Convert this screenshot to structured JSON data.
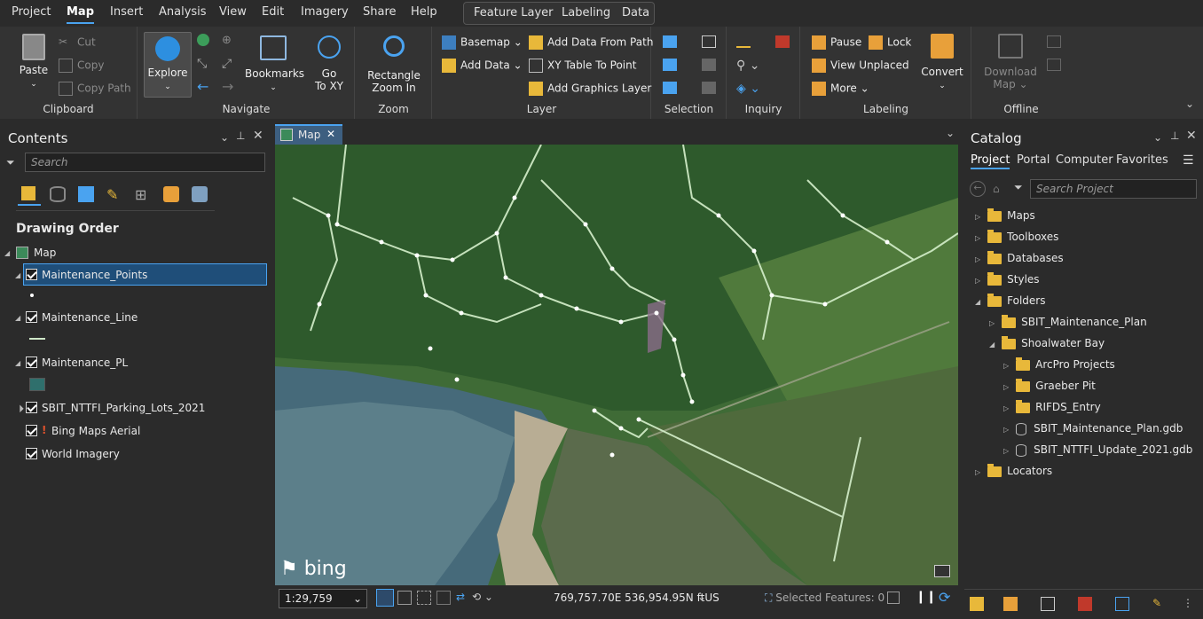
{
  "menu": {
    "tabs": [
      "Project",
      "Map",
      "Insert",
      "Analysis",
      "View",
      "Edit",
      "Imagery",
      "Share",
      "Help"
    ],
    "active": "Map",
    "context_tabs": [
      "Feature Layer",
      "Labeling",
      "Data"
    ]
  },
  "ribbon": {
    "clipboard": {
      "label": "Clipboard",
      "paste": "Paste",
      "cut": "Cut",
      "copy": "Copy",
      "copy_path": "Copy Path"
    },
    "navigate": {
      "label": "Navigate",
      "explore": "Explore",
      "bookmarks": "Bookmarks",
      "go_to_xy_1": "Go",
      "go_to_xy_2": "To XY"
    },
    "zoom": {
      "label": "Zoom",
      "rect1": "Rectangle",
      "rect2": "Zoom In"
    },
    "layer": {
      "label": "Layer",
      "basemap": "Basemap",
      "add_data": "Add Data",
      "add_data_from_path": "Add Data From Path",
      "xy_table": "XY Table To Point",
      "add_graphics": "Add Graphics Layer"
    },
    "selection": {
      "label": "Selection"
    },
    "inquiry": {
      "label": "Inquiry"
    },
    "labeling": {
      "label": "Labeling",
      "pause": "Pause",
      "lock": "Lock",
      "view_unplaced": "View Unplaced",
      "more": "More",
      "convert": "Convert"
    },
    "offline": {
      "label": "Offline",
      "download1": "Download",
      "download2": "Map"
    }
  },
  "contents": {
    "title": "Contents",
    "search_placeholder": "Search",
    "drawing_order": "Drawing Order",
    "map": "Map",
    "layers": [
      "Maintenance_Points",
      "Maintenance_Line",
      "Maintenance_PL",
      "SBIT_NTTFI_Parking_Lots_2021",
      "Bing Maps Aerial",
      "World Imagery"
    ]
  },
  "map": {
    "tab": "Map",
    "scale": "1:29,759",
    "coords": "769,757.70E 536,954.95N ftUS",
    "selected": "Selected Features: 0",
    "logo": "bing"
  },
  "catalog": {
    "title": "Catalog",
    "tabs": [
      "Project",
      "Portal",
      "Computer",
      "Favorites"
    ],
    "search_placeholder": "Search Project",
    "items": {
      "maps": "Maps",
      "toolboxes": "Toolboxes",
      "databases": "Databases",
      "styles": "Styles",
      "folders": "Folders",
      "sbit_plan": "SBIT_Maintenance_Plan",
      "shoalwater": "Shoalwater Bay",
      "arcpro": "ArcPro Projects",
      "graeber": "Graeber Pit",
      "rifds": "RIFDS_Entry",
      "gdb1": "SBIT_Maintenance_Plan.gdb",
      "gdb2": "SBIT_NTTFI_Update_2021.gdb",
      "locators": "Locators"
    }
  },
  "colors": {
    "accent": "#4aa3f0",
    "folder": "#e8b83a",
    "selected_row": "#1f4e79"
  }
}
